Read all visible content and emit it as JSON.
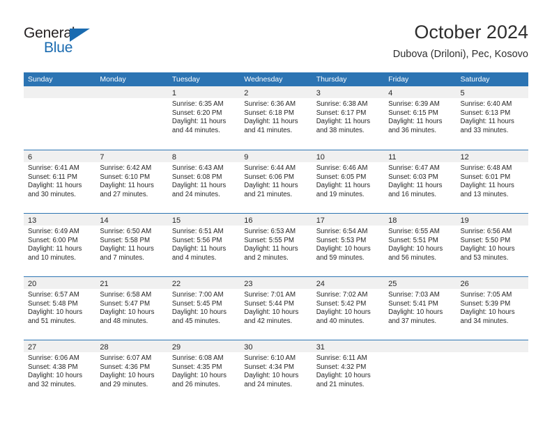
{
  "logo": {
    "word_top": "General",
    "word_bottom": "Blue",
    "triangle_color": "#1a6bb0",
    "text_color": "#231f20"
  },
  "header": {
    "title": "October 2024",
    "subtitle": "Dubova (Driloni), Pec, Kosovo"
  },
  "theme": {
    "header_blue": "#2c74b3",
    "daynum_band": "#f0f0f0",
    "text": "#262626"
  },
  "calendar": {
    "weekdays": [
      "Sunday",
      "Monday",
      "Tuesday",
      "Wednesday",
      "Thursday",
      "Friday",
      "Saturday"
    ],
    "weeks": [
      [
        {
          "day": "",
          "lines": []
        },
        {
          "day": "",
          "lines": []
        },
        {
          "day": "1",
          "lines": [
            "Sunrise: 6:35 AM",
            "Sunset: 6:20 PM",
            "Daylight: 11 hours",
            "and 44 minutes."
          ]
        },
        {
          "day": "2",
          "lines": [
            "Sunrise: 6:36 AM",
            "Sunset: 6:18 PM",
            "Daylight: 11 hours",
            "and 41 minutes."
          ]
        },
        {
          "day": "3",
          "lines": [
            "Sunrise: 6:38 AM",
            "Sunset: 6:17 PM",
            "Daylight: 11 hours",
            "and 38 minutes."
          ]
        },
        {
          "day": "4",
          "lines": [
            "Sunrise: 6:39 AM",
            "Sunset: 6:15 PM",
            "Daylight: 11 hours",
            "and 36 minutes."
          ]
        },
        {
          "day": "5",
          "lines": [
            "Sunrise: 6:40 AM",
            "Sunset: 6:13 PM",
            "Daylight: 11 hours",
            "and 33 minutes."
          ]
        }
      ],
      [
        {
          "day": "6",
          "lines": [
            "Sunrise: 6:41 AM",
            "Sunset: 6:11 PM",
            "Daylight: 11 hours",
            "and 30 minutes."
          ]
        },
        {
          "day": "7",
          "lines": [
            "Sunrise: 6:42 AM",
            "Sunset: 6:10 PM",
            "Daylight: 11 hours",
            "and 27 minutes."
          ]
        },
        {
          "day": "8",
          "lines": [
            "Sunrise: 6:43 AM",
            "Sunset: 6:08 PM",
            "Daylight: 11 hours",
            "and 24 minutes."
          ]
        },
        {
          "day": "9",
          "lines": [
            "Sunrise: 6:44 AM",
            "Sunset: 6:06 PM",
            "Daylight: 11 hours",
            "and 21 minutes."
          ]
        },
        {
          "day": "10",
          "lines": [
            "Sunrise: 6:46 AM",
            "Sunset: 6:05 PM",
            "Daylight: 11 hours",
            "and 19 minutes."
          ]
        },
        {
          "day": "11",
          "lines": [
            "Sunrise: 6:47 AM",
            "Sunset: 6:03 PM",
            "Daylight: 11 hours",
            "and 16 minutes."
          ]
        },
        {
          "day": "12",
          "lines": [
            "Sunrise: 6:48 AM",
            "Sunset: 6:01 PM",
            "Daylight: 11 hours",
            "and 13 minutes."
          ]
        }
      ],
      [
        {
          "day": "13",
          "lines": [
            "Sunrise: 6:49 AM",
            "Sunset: 6:00 PM",
            "Daylight: 11 hours",
            "and 10 minutes."
          ]
        },
        {
          "day": "14",
          "lines": [
            "Sunrise: 6:50 AM",
            "Sunset: 5:58 PM",
            "Daylight: 11 hours",
            "and 7 minutes."
          ]
        },
        {
          "day": "15",
          "lines": [
            "Sunrise: 6:51 AM",
            "Sunset: 5:56 PM",
            "Daylight: 11 hours",
            "and 4 minutes."
          ]
        },
        {
          "day": "16",
          "lines": [
            "Sunrise: 6:53 AM",
            "Sunset: 5:55 PM",
            "Daylight: 11 hours",
            "and 2 minutes."
          ]
        },
        {
          "day": "17",
          "lines": [
            "Sunrise: 6:54 AM",
            "Sunset: 5:53 PM",
            "Daylight: 10 hours",
            "and 59 minutes."
          ]
        },
        {
          "day": "18",
          "lines": [
            "Sunrise: 6:55 AM",
            "Sunset: 5:51 PM",
            "Daylight: 10 hours",
            "and 56 minutes."
          ]
        },
        {
          "day": "19",
          "lines": [
            "Sunrise: 6:56 AM",
            "Sunset: 5:50 PM",
            "Daylight: 10 hours",
            "and 53 minutes."
          ]
        }
      ],
      [
        {
          "day": "20",
          "lines": [
            "Sunrise: 6:57 AM",
            "Sunset: 5:48 PM",
            "Daylight: 10 hours",
            "and 51 minutes."
          ]
        },
        {
          "day": "21",
          "lines": [
            "Sunrise: 6:58 AM",
            "Sunset: 5:47 PM",
            "Daylight: 10 hours",
            "and 48 minutes."
          ]
        },
        {
          "day": "22",
          "lines": [
            "Sunrise: 7:00 AM",
            "Sunset: 5:45 PM",
            "Daylight: 10 hours",
            "and 45 minutes."
          ]
        },
        {
          "day": "23",
          "lines": [
            "Sunrise: 7:01 AM",
            "Sunset: 5:44 PM",
            "Daylight: 10 hours",
            "and 42 minutes."
          ]
        },
        {
          "day": "24",
          "lines": [
            "Sunrise: 7:02 AM",
            "Sunset: 5:42 PM",
            "Daylight: 10 hours",
            "and 40 minutes."
          ]
        },
        {
          "day": "25",
          "lines": [
            "Sunrise: 7:03 AM",
            "Sunset: 5:41 PM",
            "Daylight: 10 hours",
            "and 37 minutes."
          ]
        },
        {
          "day": "26",
          "lines": [
            "Sunrise: 7:05 AM",
            "Sunset: 5:39 PM",
            "Daylight: 10 hours",
            "and 34 minutes."
          ]
        }
      ],
      [
        {
          "day": "27",
          "lines": [
            "Sunrise: 6:06 AM",
            "Sunset: 4:38 PM",
            "Daylight: 10 hours",
            "and 32 minutes."
          ]
        },
        {
          "day": "28",
          "lines": [
            "Sunrise: 6:07 AM",
            "Sunset: 4:36 PM",
            "Daylight: 10 hours",
            "and 29 minutes."
          ]
        },
        {
          "day": "29",
          "lines": [
            "Sunrise: 6:08 AM",
            "Sunset: 4:35 PM",
            "Daylight: 10 hours",
            "and 26 minutes."
          ]
        },
        {
          "day": "30",
          "lines": [
            "Sunrise: 6:10 AM",
            "Sunset: 4:34 PM",
            "Daylight: 10 hours",
            "and 24 minutes."
          ]
        },
        {
          "day": "31",
          "lines": [
            "Sunrise: 6:11 AM",
            "Sunset: 4:32 PM",
            "Daylight: 10 hours",
            "and 21 minutes."
          ]
        },
        {
          "day": "",
          "lines": []
        },
        {
          "day": "",
          "lines": []
        }
      ]
    ]
  }
}
